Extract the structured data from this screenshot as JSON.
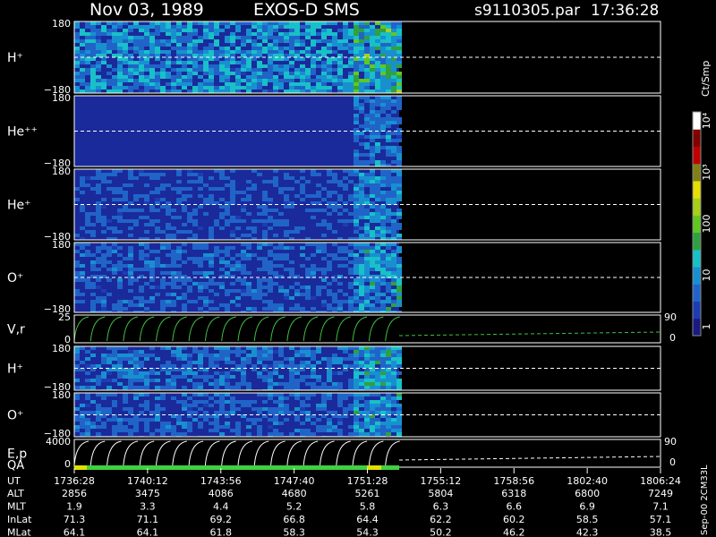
{
  "header": {
    "date": "Nov 03, 1989",
    "instrument": "EXOS-D SMS",
    "file": "s9110305.par",
    "time": "17:36:28"
  },
  "colorbar": {
    "unit": "Ct/Smp",
    "ticks": [
      {
        "value": 1,
        "label": "1"
      },
      {
        "value": 10,
        "label": "10"
      },
      {
        "value": 100,
        "label": "100"
      },
      {
        "value": 1000,
        "label": "10³"
      },
      {
        "value": 10000,
        "label": "10⁴"
      }
    ],
    "colors": [
      "#1a1a80",
      "#1e3cb4",
      "#2064c8",
      "#1890d0",
      "#18c0c8",
      "#30a040",
      "#60c820",
      "#a8d018",
      "#e8e000",
      "#808018",
      "#c00000",
      "#800000",
      "#ffffff"
    ]
  },
  "panels": [
    {
      "label": "H⁺",
      "kind": "spectrogram",
      "top": "180",
      "bottom": "−180",
      "level": 0.55
    },
    {
      "label": "He⁺⁺",
      "kind": "spectrogram",
      "top": "180",
      "bottom": "−180",
      "level": 0.2
    },
    {
      "label": "He⁺",
      "kind": "spectrogram",
      "top": "180",
      "bottom": "−180",
      "level": 0.3
    },
    {
      "label": "O⁺",
      "kind": "spectrogram",
      "top": "180",
      "bottom": "−180",
      "level": 0.35
    },
    {
      "label": "V,r",
      "kind": "line",
      "top": "25",
      "bottom": "0",
      "right_top": "90",
      "right_bottom": "0"
    },
    {
      "label": "H⁺",
      "kind": "spectrogram",
      "top": "180",
      "bottom": "−180",
      "level": 0.4
    },
    {
      "label": "O⁺",
      "kind": "spectrogram",
      "top": "180",
      "bottom": "−180",
      "level": 0.35
    },
    {
      "label": "E,p",
      "label2": "QA",
      "kind": "line",
      "top": "4000",
      "bottom": "0",
      "right_top": "90",
      "right_bottom": "0"
    }
  ],
  "footer_note": "Sep-00 2CM33L",
  "chart_data": {
    "type": "heatmap",
    "title": "Nov 03, 1989  EXOS-D SMS",
    "x_row_label": "UT",
    "x": [
      "1736:28",
      "1740:12",
      "1743:56",
      "1747:40",
      "1751:28",
      "1755:12",
      "1758:56",
      "1802:40",
      "1806:24"
    ],
    "ephemeris": [
      {
        "name": "ALT",
        "values": [
          "2856",
          "3475",
          "4086",
          "4680",
          "5261",
          "5804",
          "6318",
          "6800",
          "7249"
        ]
      },
      {
        "name": "MLT",
        "values": [
          "1.9",
          "3.3",
          "4.4",
          "5.2",
          "5.8",
          "6.3",
          "6.6",
          "6.9",
          "7.1"
        ]
      },
      {
        "name": "InLat",
        "values": [
          "71.3",
          "71.1",
          "69.2",
          "66.8",
          "64.4",
          "62.2",
          "60.2",
          "58.5",
          "57.1"
        ]
      },
      {
        "name": "MLat",
        "values": [
          "64.1",
          "64.1",
          "61.8",
          "58.3",
          "54.3",
          "50.2",
          "46.2",
          "42.3",
          "38.5"
        ]
      }
    ],
    "data_end_ut": "1752:00",
    "y_range": [
      -180,
      180
    ]
  }
}
